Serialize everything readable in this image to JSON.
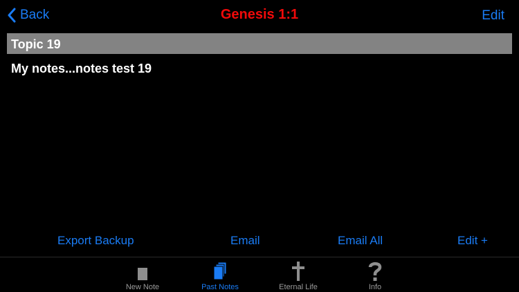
{
  "navbar": {
    "back_label": "Back",
    "title": "Genesis 1:1",
    "edit_label": "Edit"
  },
  "topic": {
    "header": "Topic 19",
    "note": "My notes...notes test 19"
  },
  "actions": {
    "export_backup": "Export Backup",
    "email": "Email",
    "email_all": "Email All",
    "edit_plus": "Edit +"
  },
  "tabs": [
    {
      "label": "New Note",
      "icon": "new-note-icon",
      "active": false
    },
    {
      "label": "Past Notes",
      "icon": "past-notes-icon",
      "active": true
    },
    {
      "label": "Eternal Life",
      "icon": "cross-icon",
      "active": false
    },
    {
      "label": "Info",
      "icon": "question-mark-icon",
      "active": false
    }
  ],
  "colors": {
    "accent": "#1a7cf5",
    "title": "#f00a0a",
    "header_bg": "#838383",
    "background": "#000000",
    "inactive_tab": "#9a9a9a"
  }
}
